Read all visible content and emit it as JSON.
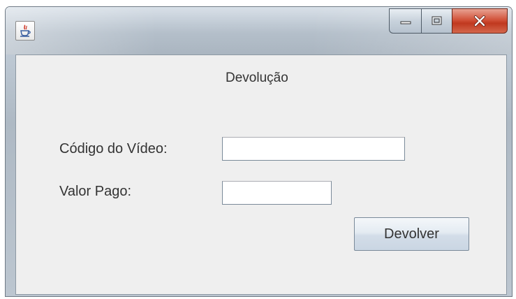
{
  "window": {
    "title": "",
    "controls": {
      "minimize_icon": "minimize-icon",
      "maximize_icon": "maximize-icon",
      "close_icon": "close-icon"
    },
    "app_icon": "java-cup-icon"
  },
  "form": {
    "heading": "Devolução",
    "codigo_label": "Código do Vídeo:",
    "codigo_value": "",
    "valor_label": "Valor Pago:",
    "valor_value": "",
    "submit_label": "Devolver"
  },
  "colors": {
    "panel_bg": "#efefef",
    "close_red": "#c0381f",
    "text": "#333333"
  }
}
